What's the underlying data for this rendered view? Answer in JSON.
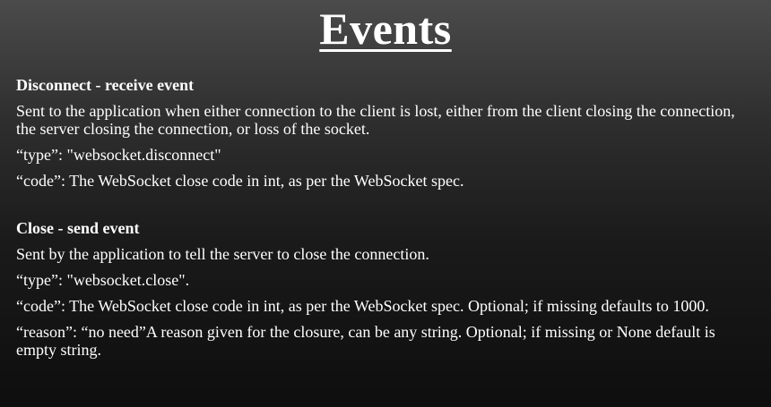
{
  "slide": {
    "title": "Events",
    "sections": [
      {
        "heading": "Disconnect - receive event",
        "paragraphs": [
          "Sent to the application when either connection to the client is lost, either from the client closing the connection, the server closing the connection, or loss of the socket.",
          "“type”: \"websocket.disconnect\"",
          "“code”: The WebSocket close code in int, as per the WebSocket spec."
        ]
      },
      {
        "heading": "Close - send event",
        "paragraphs": [
          "Sent by the application to tell the server to close the connection.",
          "“type”:  \"websocket.close\".",
          "“code”: The WebSocket close code in int, as per the WebSocket spec. Optional; if missing defaults to 1000.",
          "“reason”: “no need”A reason given for the closure, can be any string. Optional; if missing or None default is empty string."
        ]
      }
    ]
  }
}
